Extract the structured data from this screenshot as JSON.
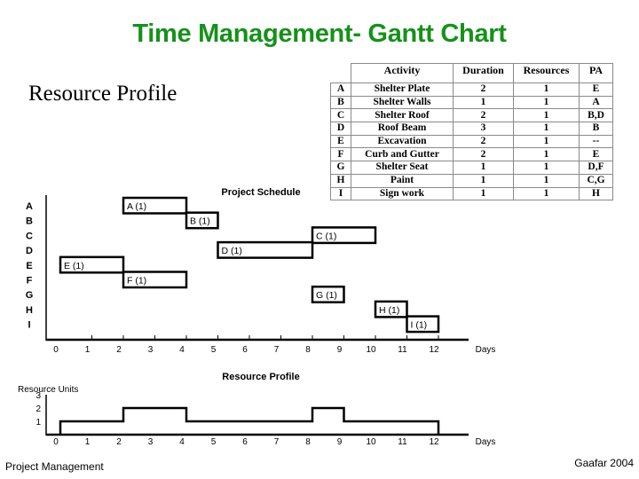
{
  "title": "Time Management- Gantt Chart",
  "subtitle": "Resource Profile",
  "activity_table": {
    "headers": [
      "",
      "Activity",
      "Duration",
      "Resources",
      "PA"
    ],
    "rows": [
      {
        "id": "A",
        "activity": "Shelter Plate",
        "duration": "2",
        "resources": "1",
        "pa": "E"
      },
      {
        "id": "B",
        "activity": "Shelter Walls",
        "duration": "1",
        "resources": "1",
        "pa": "A"
      },
      {
        "id": "C",
        "activity": "Shelter Roof",
        "duration": "2",
        "resources": "1",
        "pa": "B,D"
      },
      {
        "id": "D",
        "activity": "Roof Beam",
        "duration": "3",
        "resources": "1",
        "pa": "B"
      },
      {
        "id": "E",
        "activity": "Excavation",
        "duration": "2",
        "resources": "1",
        "pa": "--"
      },
      {
        "id": "F",
        "activity": "Curb and Gutter",
        "duration": "2",
        "resources": "1",
        "pa": "E"
      },
      {
        "id": "G",
        "activity": "Shelter Seat",
        "duration": "1",
        "resources": "1",
        "pa": "D,F"
      },
      {
        "id": "H",
        "activity": "Paint",
        "duration": "1",
        "resources": "1",
        "pa": "C,G"
      },
      {
        "id": "I",
        "activity": "Sign work",
        "duration": "1",
        "resources": "1",
        "pa": "H"
      }
    ]
  },
  "chart_data": [
    {
      "type": "gantt",
      "title": "Project Schedule",
      "xlabel": "Days",
      "ylabel": "",
      "xlim": [
        0,
        12
      ],
      "x_ticks": [
        "0",
        "1",
        "2",
        "3",
        "4",
        "5",
        "6",
        "7",
        "8",
        "9",
        "10",
        "11",
        "12"
      ],
      "rows": [
        "A",
        "B",
        "C",
        "D",
        "E",
        "F",
        "G",
        "H",
        "I"
      ],
      "tasks": [
        {
          "id": "A",
          "label": "A (1)",
          "start": 2,
          "end": 4
        },
        {
          "id": "B",
          "label": "B (1)",
          "start": 4,
          "end": 5
        },
        {
          "id": "C",
          "label": "C (1)",
          "start": 8,
          "end": 10
        },
        {
          "id": "D",
          "label": "D (1)",
          "start": 5,
          "end": 8
        },
        {
          "id": "E",
          "label": "E (1)",
          "start": 0,
          "end": 2
        },
        {
          "id": "F",
          "label": "F (1)",
          "start": 2,
          "end": 4
        },
        {
          "id": "G",
          "label": "G (1)",
          "start": 8,
          "end": 9
        },
        {
          "id": "H",
          "label": "H (1)",
          "start": 10,
          "end": 11
        },
        {
          "id": "I",
          "label": "I (1)",
          "start": 11,
          "end": 12
        }
      ]
    },
    {
      "type": "line",
      "step": true,
      "title": "Resource Profile",
      "xlabel": "Days",
      "ylabel": "Resource Units",
      "xlim": [
        0,
        12
      ],
      "ylim": [
        0,
        3
      ],
      "x_ticks": [
        "0",
        "1",
        "2",
        "3",
        "4",
        "5",
        "6",
        "7",
        "8",
        "9",
        "10",
        "11",
        "12"
      ],
      "y_ticks": [
        "1",
        "2",
        "3"
      ],
      "segments": [
        {
          "start": 0,
          "end": 2,
          "value": 1
        },
        {
          "start": 2,
          "end": 4,
          "value": 2
        },
        {
          "start": 4,
          "end": 8,
          "value": 1
        },
        {
          "start": 8,
          "end": 9,
          "value": 2
        },
        {
          "start": 9,
          "end": 12,
          "value": 1
        }
      ]
    }
  ],
  "footer": {
    "left": "Project Management",
    "right": "Gaafar 2004"
  }
}
